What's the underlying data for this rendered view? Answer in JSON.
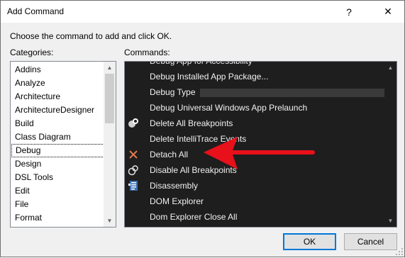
{
  "window": {
    "title": "Add Command",
    "help_glyph": "?",
    "close_glyph": "✕"
  },
  "dialog": {
    "instruction": "Choose the command to add and click OK.",
    "categories_label": "Categories:",
    "commands_label": "Commands:",
    "ok_label": "OK",
    "cancel_label": "Cancel"
  },
  "categories": {
    "items": [
      "Addins",
      "Analyze",
      "Architecture",
      "ArchitectureDesigner",
      "Build",
      "Class Diagram",
      "Debug",
      "Design",
      "DSL Tools",
      "Edit",
      "File",
      "Format"
    ],
    "selected": "Debug"
  },
  "commands": {
    "partial_top": "Debug App for Accessibility",
    "items": [
      {
        "label": "Debug Installed App Package...",
        "icon": ""
      },
      {
        "label": "Debug Type",
        "icon": ""
      },
      {
        "label": "Debug Universal Windows App Prelaunch",
        "icon": ""
      },
      {
        "label": "Delete All Breakpoints",
        "icon": "delete-breakpoints-icon"
      },
      {
        "label": "Delete IntelliTrace Events",
        "icon": ""
      },
      {
        "label": "Detach All",
        "icon": "detach-all-icon"
      },
      {
        "label": "Disable All Breakpoints",
        "icon": "disable-breakpoints-icon"
      },
      {
        "label": "Disassembly",
        "icon": "disassembly-icon"
      },
      {
        "label": "DOM Explorer",
        "icon": ""
      }
    ],
    "partial_bottom": "Dom Explorer Close All",
    "highlighted": "Detach All"
  },
  "colors": {
    "commands_background": "#1e1e1e",
    "annotation_arrow": "#e8101a",
    "ok_border": "#0078d7"
  }
}
